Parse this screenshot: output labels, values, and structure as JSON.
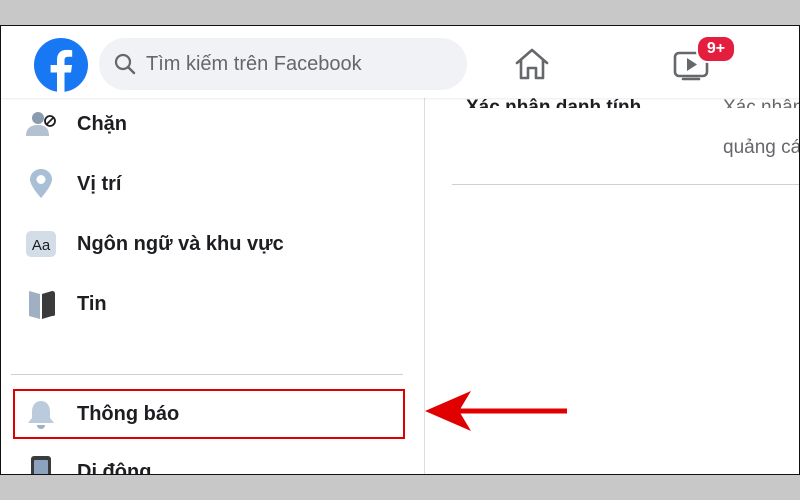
{
  "header": {
    "search_placeholder": "Tìm kiếm trên Facebook",
    "watch_badge": "9+"
  },
  "sidebar": {
    "items": [
      {
        "label": "Chặn",
        "icon": "blocked-user-icon"
      },
      {
        "label": "Vị trí",
        "icon": "location-pin-icon"
      },
      {
        "label": "Ngôn ngữ và khu vực",
        "icon": "language-icon"
      },
      {
        "label": "Tin",
        "icon": "book-icon"
      },
      {
        "label": "Thông báo",
        "icon": "bell-icon"
      },
      {
        "label": "Di động",
        "icon": "mobile-phone-icon"
      }
    ]
  },
  "content": {
    "row_title": "Xác nhận danh tính",
    "row_desc_top": "Xác nhận",
    "row_desc_bottom": "quảng cá"
  },
  "colors": {
    "facebook_blue": "#1877f2",
    "badge_red": "#e41e3f",
    "annotation_red": "#dd0000"
  }
}
